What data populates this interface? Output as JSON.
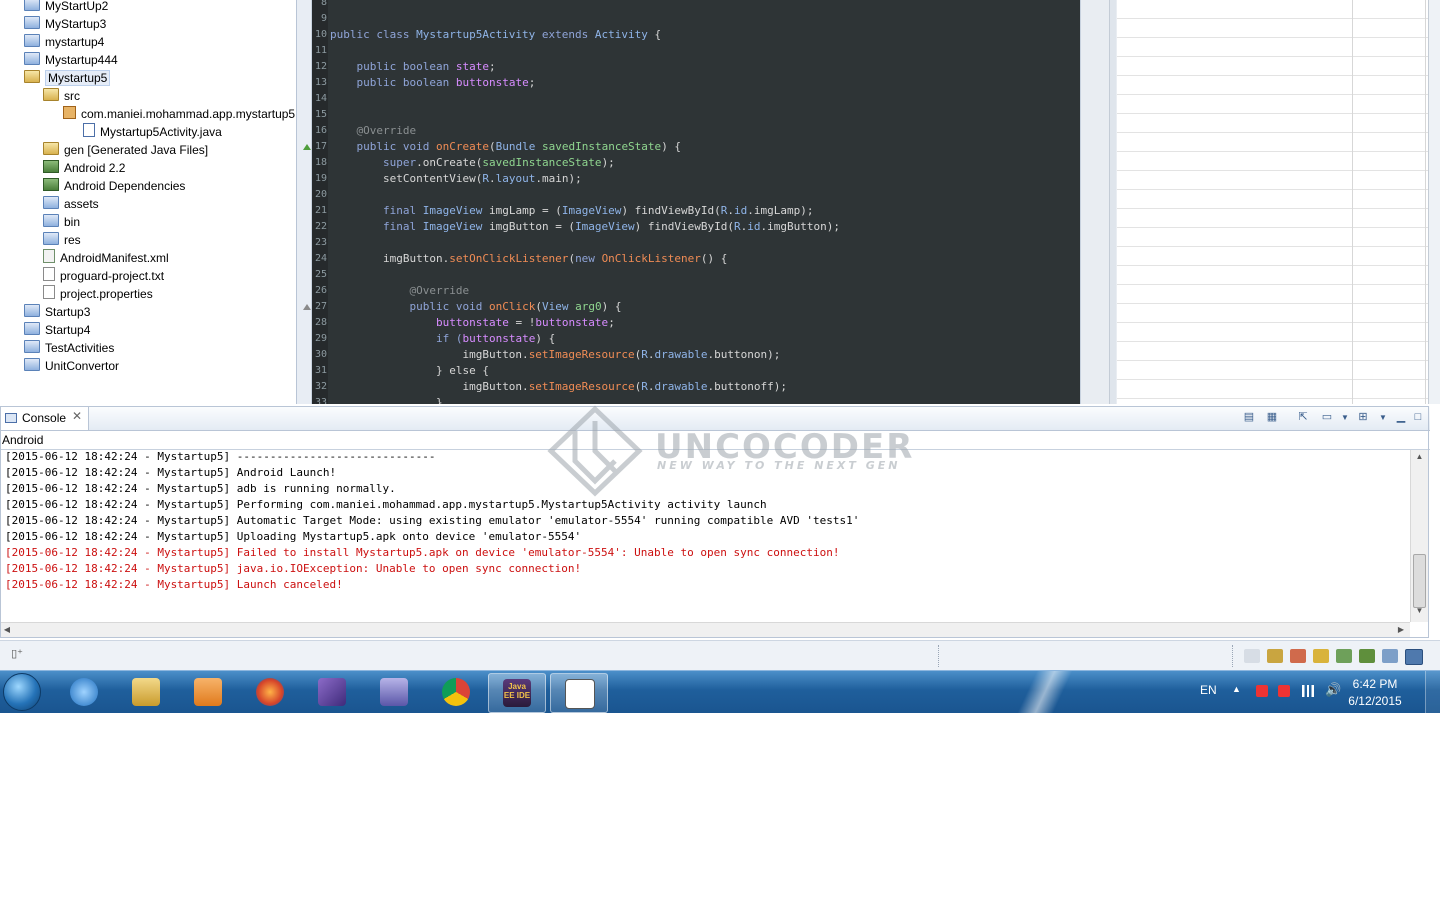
{
  "explorer": {
    "items": [
      {
        "label": "MyStartUp2",
        "icon": "folder-icon"
      },
      {
        "label": "MyStartup3",
        "icon": "folder-icon"
      },
      {
        "label": "mystartup4",
        "icon": "folder-icon"
      },
      {
        "label": "Mystartup444",
        "icon": "folder-icon"
      },
      {
        "label": "Mystartup5",
        "icon": "open-project-icon"
      },
      {
        "label": "src",
        "icon": "source-folder-icon"
      },
      {
        "label": "com.maniei.mohammad.app.mystartup5",
        "icon": "package-icon"
      },
      {
        "label": "Mystartup5Activity.java",
        "icon": "java-file-icon"
      },
      {
        "label": "gen [Generated Java Files]",
        "icon": "source-folder-icon"
      },
      {
        "label": "Android 2.2",
        "icon": "library-icon"
      },
      {
        "label": "Android Dependencies",
        "icon": "library-icon"
      },
      {
        "label": "assets",
        "icon": "folder-icon"
      },
      {
        "label": "bin",
        "icon": "folder-icon"
      },
      {
        "label": "res",
        "icon": "folder-icon"
      },
      {
        "label": "AndroidManifest.xml",
        "icon": "xml-file-icon"
      },
      {
        "label": "proguard-project.txt",
        "icon": "text-file-icon"
      },
      {
        "label": "project.properties",
        "icon": "text-file-icon"
      },
      {
        "label": "Startup3",
        "icon": "folder-icon"
      },
      {
        "label": "Startup4",
        "icon": "folder-icon"
      },
      {
        "label": "TestActivities",
        "icon": "folder-icon"
      },
      {
        "label": "UnitConvertor",
        "icon": "folder-icon"
      }
    ]
  },
  "editor": {
    "line_numbers": [
      "8",
      "9",
      "10",
      "11",
      "12",
      "13",
      "14",
      "15",
      "16",
      "17",
      "18",
      "19",
      "20",
      "21",
      "22",
      "23",
      "24",
      "25",
      "26",
      "27",
      "28",
      "29",
      "30",
      "31",
      "32",
      "33"
    ],
    "colors": {
      "background": "#2e3436",
      "keyword": "#8fa4d8",
      "field": "#d78cff",
      "method": "#f08c55",
      "annotation": "#8a8f91"
    },
    "tokens": {
      "l10": [
        "public class ",
        "Mystartup5Activity",
        " extends ",
        "Activity",
        " {"
      ],
      "l12": [
        "public boolean ",
        "state",
        ";"
      ],
      "l13": [
        "public boolean ",
        "buttonstate",
        ";"
      ],
      "l16": [
        "@Override"
      ],
      "l17": [
        "public void ",
        "onCreate",
        "(",
        "Bundle",
        " ",
        "savedInstanceState",
        ") {"
      ],
      "l18": [
        "super",
        ".",
        "onCreate",
        "(",
        "savedInstanceState",
        ");"
      ],
      "l19": [
        "setContentView(",
        "R",
        ".",
        "layout",
        ".main);"
      ],
      "l21": [
        "final ",
        "ImageView",
        " imgLamp = (",
        "ImageView",
        ") findViewById(",
        "R",
        ".",
        "id",
        ".imgLamp);"
      ],
      "l22": [
        "final ",
        "ImageView",
        " imgButton = (",
        "ImageView",
        ") findViewById(",
        "R",
        ".",
        "id",
        ".imgButton);"
      ],
      "l24": [
        "imgButton.",
        "setOnClickListener",
        "(",
        "new ",
        "OnClickListener",
        "() {"
      ],
      "l26": [
        "@Override"
      ],
      "l27": [
        "public void ",
        "onClick",
        "(",
        "View",
        " ",
        "arg0",
        ") {"
      ],
      "l28": [
        "buttonstate",
        " = !",
        "buttonstate",
        ";"
      ],
      "l29": [
        "if (",
        "buttonstate",
        ") {"
      ],
      "l30": [
        "imgButton.",
        "setImageResource",
        "(",
        "R",
        ".",
        "drawable",
        ".buttonon);"
      ],
      "l31": [
        "} else {"
      ],
      "l32": [
        "imgButton.",
        "setImageResource",
        "(",
        "R",
        ".",
        "drawable",
        ".buttonoff);"
      ],
      "l33": [
        "}"
      ]
    }
  },
  "console": {
    "tab_label": "Console",
    "close_glyph": "✕",
    "sub_label": "Android",
    "lines": [
      "[2015-06-12 18:42:24 - Mystartup5] ------------------------------",
      "[2015-06-12 18:42:24 - Mystartup5] Android Launch!",
      "[2015-06-12 18:42:24 - Mystartup5] adb is running normally.",
      "[2015-06-12 18:42:24 - Mystartup5] Performing com.maniei.mohammad.app.mystartup5.Mystartup5Activity activity launch",
      "[2015-06-12 18:42:24 - Mystartup5] Automatic Target Mode: using existing emulator 'emulator-5554' running compatible AVD 'tests1'",
      "[2015-06-12 18:42:24 - Mystartup5] Uploading Mystartup5.apk onto device 'emulator-5554'",
      "[2015-06-12 18:42:24 - Mystartup5] Failed to install Mystartup5.apk on device 'emulator-5554': Unable to open sync connection!",
      "[2015-06-12 18:42:24 - Mystartup5] java.io.IOException: Unable to open sync connection!",
      "[2015-06-12 18:42:24 - Mystartup5] Launch canceled!"
    ],
    "error_color": "#cc1010"
  },
  "watermark": {
    "name": "UNCOCODER",
    "tagline": "NEW WAY TO THE NEXT GEN"
  },
  "taskbar": {
    "language": "EN",
    "time": "6:42 PM",
    "date": "6/12/2015",
    "java_label": "Java EE IDE",
    "apps": [
      "internet-explorer-icon",
      "file-explorer-icon",
      "media-player-icon",
      "firefox-icon",
      "visual-studio-icon",
      "ship-app-icon",
      "chrome-icon",
      "eclipse-icon",
      "document-icon"
    ]
  }
}
